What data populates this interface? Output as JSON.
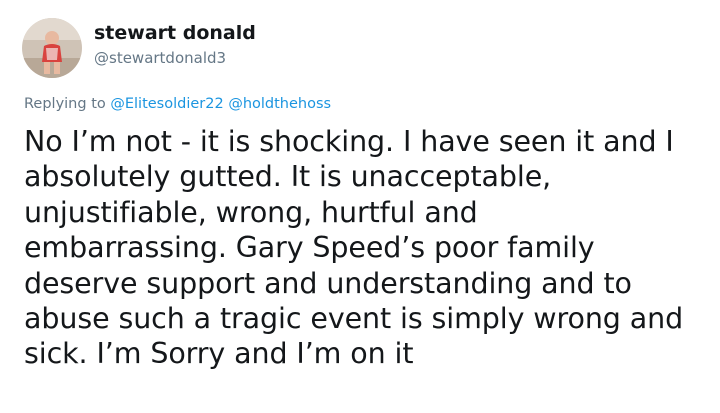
{
  "tweet": {
    "display_name": "stewart donald",
    "handle": "@stewartdonald3",
    "replying_to_label": "Replying to",
    "mentions": [
      "@Elitesoldier22",
      "@holdthehoss"
    ],
    "text_lines": [
      "No I’m not - it is shocking. I have seen it and I",
      "absolutely gutted. It is unacceptable,",
      "unjustifiable, wrong, hurtful and",
      "embarrassing. Gary Speed’s poor family",
      "deserve support and understanding and to",
      "abuse such a tragic event is simply wrong and",
      "sick. I’m Sorry and I’m on it"
    ]
  },
  "colors": {
    "text": "#14171a",
    "secondary": "#657786",
    "link": "#1b95e0"
  }
}
